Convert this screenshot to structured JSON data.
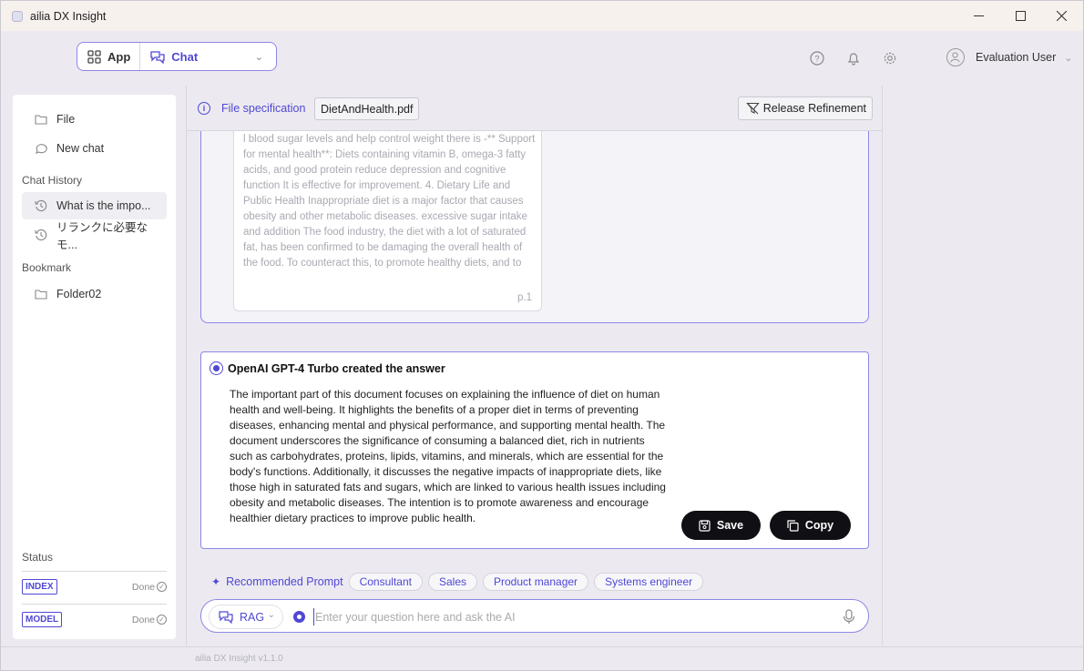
{
  "window": {
    "title": "ailia DX Insight"
  },
  "switcher": {
    "app_label": "App",
    "chat_label": "Chat"
  },
  "user": {
    "name": "Evaluation User"
  },
  "sidebar": {
    "items": [
      {
        "label": "File",
        "icon": "folder-icon"
      },
      {
        "label": "New chat",
        "icon": "chat-bubble-icon"
      }
    ],
    "chat_history_title": "Chat History",
    "history": [
      {
        "label": "What is the impo...",
        "icon": "history-icon"
      },
      {
        "label": "リランクに必要なモ...",
        "icon": "history-icon"
      }
    ],
    "bookmark_title": "Bookmark",
    "bookmarks": [
      {
        "label": "Folder02",
        "icon": "folder-icon"
      }
    ],
    "status_title": "Status",
    "status": [
      {
        "badge": "INDEX",
        "state": "Done"
      },
      {
        "badge": "MODEL",
        "state": "Done"
      }
    ]
  },
  "filebar": {
    "label": "File specification",
    "file": "DietAndHealth.pdf",
    "release_label": "Release Refinement"
  },
  "reference": {
    "text": "l blood sugar levels and help control weight there is -** Support for mental health**: Diets containing vitamin B, omega-3 fatty acids, and good protein reduce depression and cognitive function It is effective for improvement. 4. Dietary Life and Public Health Inappropriate diet is a major factor that causes obesity and other metabolic diseases. excessive sugar intake and addition The food industry, the diet with a lot of saturated fat, has been confirmed to be damaging the overall health of the food. To counteract this, to promote healthy diets, and to",
    "page": "p.1"
  },
  "answer": {
    "header": "OpenAI GPT-4 Turbo created the answer",
    "body": "The important part of this document focuses on explaining the influence of diet on human health and well-being. It highlights the benefits of a proper diet in terms of preventing diseases, enhancing mental and physical performance, and supporting mental health. The document underscores the significance of consuming a balanced diet, rich in nutrients such as carbohydrates, proteins, lipids, vitamins, and minerals, which are essential for the body's functions. Additionally, it discusses the negative impacts of inappropriate diets, like those high in saturated fats and sugars, which are linked to various health issues including obesity and metabolic diseases. The intention is to promote awareness and encourage healthier dietary practices to improve public health.",
    "save_label": "Save",
    "copy_label": "Copy"
  },
  "recommended": {
    "label": "Recommended Prompt",
    "chips": [
      "Consultant",
      "Sales",
      "Product manager",
      "Systems engineer"
    ]
  },
  "input": {
    "mode": "RAG",
    "placeholder": "Enter your question here and ask the AI"
  },
  "footer": {
    "version": "ailia DX Insight v1.1.0"
  },
  "colors": {
    "accent": "#4f47d4",
    "button_dark": "#0f0f14"
  }
}
